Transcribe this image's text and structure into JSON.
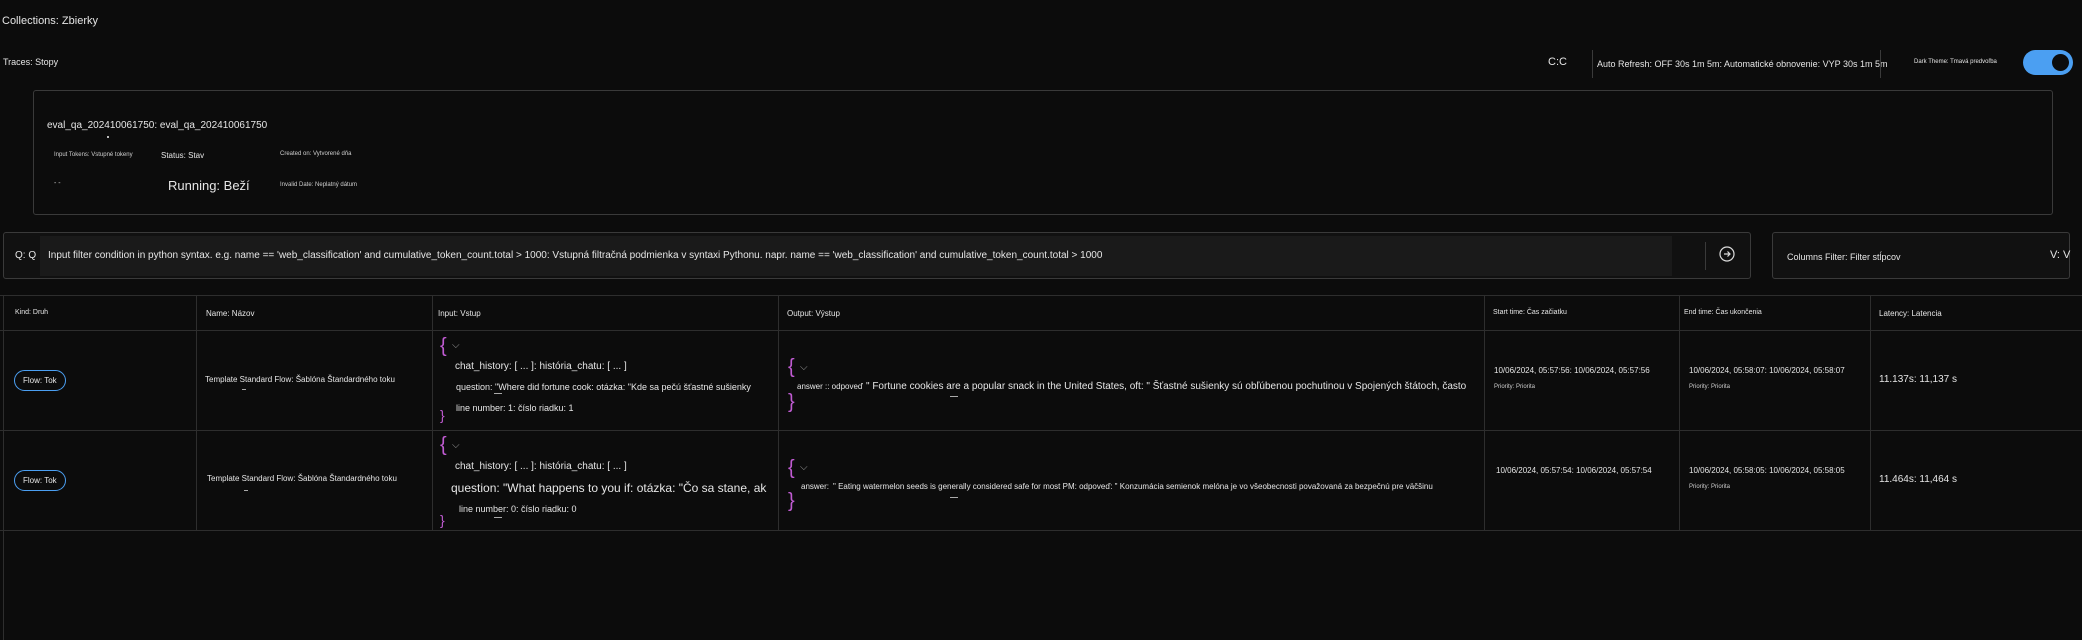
{
  "header": {
    "collections": "Collections: Zbierky",
    "traces": "Traces: Stopy"
  },
  "toolbar": {
    "refresh_icon": "C:C",
    "auto_refresh": "Auto Refresh: OFF 30s 1m 5m: Automatické obnovenie: VYP 30s 1m 5m",
    "dark_theme": "Dark Theme: Tmavá predvoľba",
    "dark_theme_on": true,
    "accent": "#4b9ff2"
  },
  "run": {
    "name": "eval_qa_202410061750: eval_qa_202410061750",
    "input_tokens_label": "Input Tokens: Vstupné tokeny",
    "status_label": "Status: Stav",
    "created_label": "Created on: Vytvorené dňa",
    "input_tokens_value": "- -",
    "status_value": "Running: Beží",
    "created_value": "Invalid Date: Neplatný dátum"
  },
  "filter": {
    "q_label": "Q: Q",
    "placeholder": "Input filter condition in python syntax. e.g. name == 'web_classification' and cumulative_token_count.total > 1000: Vstupná filtračná podmienka v syntaxi Pythonu. napr. name == 'web_classification' and cumulative_token_count.total > 1000",
    "columns_filter": "Columns Filter: Filter stĺpcov",
    "columns_chevron": "V: V"
  },
  "table": {
    "headers": {
      "kind": "Kind: Druh",
      "name": "Name: Názov",
      "input": "Input: Vstup",
      "output": "Output: Výstup",
      "start": "Start time: Čas začiatku",
      "end": "End time: Čas ukončenia",
      "latency": "Latency: Latencia"
    },
    "rows": [
      {
        "kind": "Flow: Tok",
        "name": "Template Standard Flow: Šablóna Štandardného toku",
        "input_chat_history": "chat_history: [ ... ]: história_chatu: [ ... ]",
        "input_question": "question: \"Where did fortune cook: otázka: \"Kde sa pečú šťastné sušienky",
        "input_line": "line number: 1: číslo riadku: 1",
        "output_answer_key": "answer :: odpoveď",
        "output_answer": "\" Fortune cookies are a popular snack in the United States, oft: \" Šťastné sušienky sú obľúbenou pochutinou v Spojených štátoch, často",
        "start": "10/06/2024, 05:57:56: 10/06/2024, 05:57:56",
        "start_sub": "Priority: Priorita",
        "end": "10/06/2024, 05:58:07: 10/06/2024, 05:58:07",
        "end_sub": "Priority: Priorita",
        "latency": "11.137s: 11,137 s"
      },
      {
        "kind": "Flow: Tok",
        "name": "Template Standard Flow: Šablóna Štandardného toku",
        "input_chat_history": "chat_history: [ ... ]: história_chatu: [ ... ]",
        "input_question": "question: \"What happens to you if: otázka: \"Čo sa stane, ak",
        "input_line": "line number: 0: číslo riadku: 0",
        "output_answer_key": "answer:",
        "output_answer": "\" Eating watermelon seeds is generally considered safe for most PM: odpoveď: \" Konzumácia semienok melóna je vo všeobecnosti považovaná za bezpečnú pre väčšinu",
        "start": "10/06/2024, 05:57:54: 10/06/2024, 05:57:54",
        "start_sub": "",
        "end": "10/06/2024, 05:58:05: 10/06/2024, 05:58:05",
        "end_sub": "Priority: Priorita",
        "latency": "11.464s: 11,464 s"
      }
    ]
  }
}
